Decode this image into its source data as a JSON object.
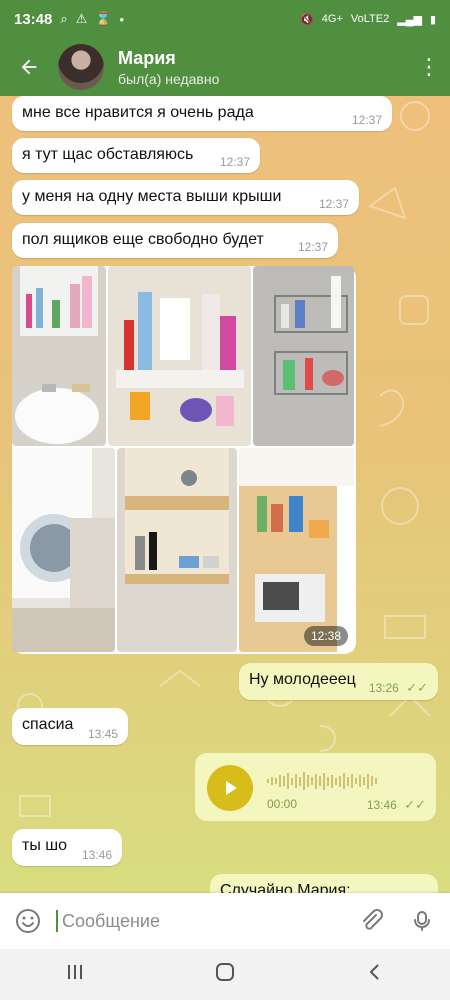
{
  "status_bar": {
    "time": "13:48",
    "network_labels": [
      "4G+",
      "VoLTE2"
    ],
    "icons": [
      "search-icon",
      "warning-icon",
      "timer-icon",
      "dot-icon",
      "mute-icon",
      "signal-icon",
      "battery-icon"
    ]
  },
  "chat_header": {
    "name": "Мария",
    "status": "был(а) недавно"
  },
  "messages": [
    {
      "text": "мне все нравится я очень рада",
      "time": "12:37"
    },
    {
      "text": "я тут щас обставляюсь",
      "time": "12:37"
    },
    {
      "text": "у меня на одну места выши крыши",
      "time": "12:37"
    },
    {
      "text": "пол ящиков еще свободно будет",
      "time": "12:37"
    },
    {
      "text": "Ну молодееец",
      "time": "13:26"
    },
    {
      "text": "спасиа",
      "time": "13:45"
    },
    {
      "text": "ты шо",
      "time": "13:46"
    }
  ],
  "photo_group": {
    "time": "12:38",
    "count": 6
  },
  "voice_message": {
    "duration": "00:00",
    "time": "13:46"
  },
  "partial_message": {
    "text": "Случайно Мария:"
  },
  "composer": {
    "placeholder": "Сообщение"
  },
  "colors": {
    "header": "#4f8f3f",
    "accent": "#d8bc19",
    "outgoing_bubble": "#f4f6bf"
  }
}
